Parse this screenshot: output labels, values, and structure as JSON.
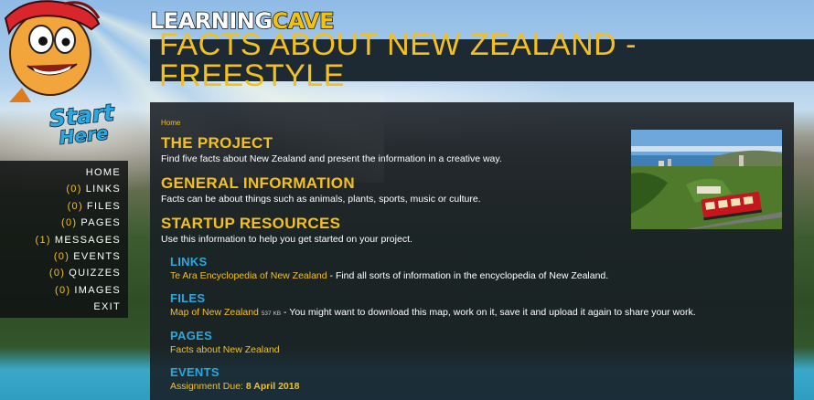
{
  "logo": {
    "part1": "LEARNING",
    "part2": "CAVE"
  },
  "page_title": "FACTS ABOUT NEW ZEALAND - FREESTYLE",
  "start_sign": {
    "line1": "Start",
    "line2": "Here"
  },
  "nav": [
    {
      "count": "",
      "label": "HOME",
      "icon": "none"
    },
    {
      "count": "(0)",
      "label": "LINKS"
    },
    {
      "count": "(0)",
      "label": "FILES"
    },
    {
      "count": "(0)",
      "label": "PAGES"
    },
    {
      "count": "(1)",
      "label": "MESSAGES"
    },
    {
      "count": "(0)",
      "label": "EVENTS"
    },
    {
      "count": "(0)",
      "label": "QUIZZES"
    },
    {
      "count": "(0)",
      "label": "IMAGES"
    },
    {
      "count": "",
      "label": "EXIT"
    }
  ],
  "breadcrumb": "Home",
  "sections": {
    "project": {
      "title": "THE PROJECT",
      "text": "Find five facts about New Zealand and present the information in a creative way."
    },
    "general": {
      "title": "GENERAL INFORMATION",
      "text": "Facts can be about things such as animals, plants, sports, music or culture."
    },
    "startup": {
      "title": "STARTUP RESOURCES",
      "text": "Use this information to help you get started on your project."
    }
  },
  "resources": {
    "links": {
      "title": "LINKS",
      "link": "Te Ara Encyclopedia of New Zealand",
      "desc": " - Find all sorts of information in the encyclopedia of New Zealand."
    },
    "files": {
      "title": "FILES",
      "link": "Map of New Zealand",
      "size": "537 KB",
      "desc": " - You might want to download this map, work on it, save it and upload it again to share your work."
    },
    "pages": {
      "title": "PAGES",
      "link": "Facts about New Zealand"
    },
    "events": {
      "title": "EVENTS",
      "label": "Assignment Due: ",
      "date": "8 April 2018"
    }
  },
  "colors": {
    "accent": "#f3c020",
    "subheading": "#29a9e1",
    "panel": "#181e24",
    "title_bar": "#1e2a33"
  },
  "icons": [
    "mascot-icon",
    "start-here-sign",
    "wellington-photo"
  ]
}
